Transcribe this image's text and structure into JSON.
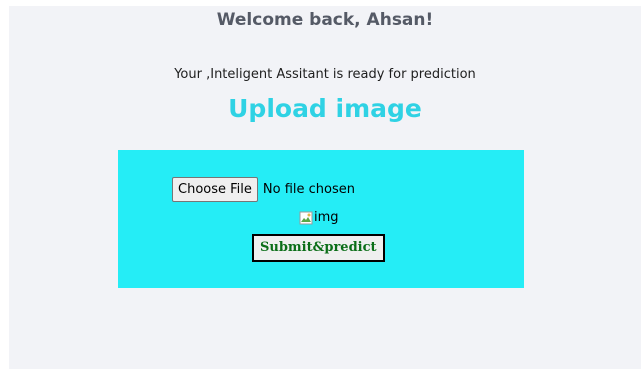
{
  "header": {
    "welcome_text": "Welcome back, Ahsan!",
    "subtitle": "Your ,Inteligent Assitant is ready for prediction"
  },
  "upload": {
    "heading": "Upload image",
    "choose_file_label": "Choose File",
    "file_status": "No file chosen",
    "image_alt": "img",
    "submit_label": "Submit&predict"
  },
  "colors": {
    "page_background": "#f2f3f7",
    "heading_accent": "#2fd2e4",
    "upload_box": "#25edf6",
    "submit_text": "#0b6e18"
  },
  "icons": {
    "broken_image": "broken-image-icon"
  }
}
